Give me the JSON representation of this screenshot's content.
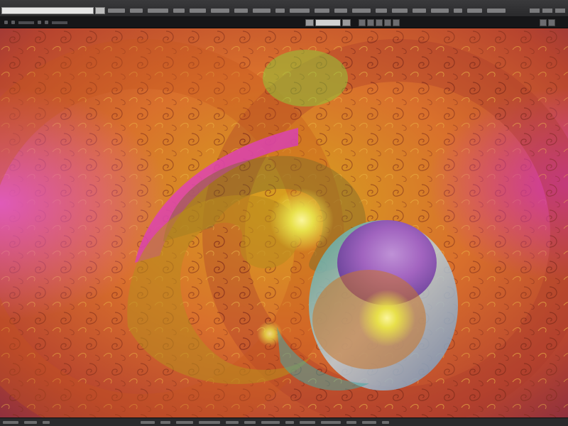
{
  "window": {
    "menu_item_count": 22,
    "accent": "#d2d2d2"
  },
  "icons": {
    "address_bar": "text-field",
    "go": "go-arrow-icon",
    "toolbar_center": [
      "frame-icon",
      "layers-icon",
      "swatch-icon"
    ]
  },
  "artwork": {
    "palette": {
      "orange": "#d9702c",
      "gold": "#d6a21e",
      "magenta": "#d23aa6",
      "purple": "#8a3fb0",
      "yellow": "#e8e04a",
      "teal": "#4aa7a0",
      "red": "#c83a2a"
    }
  }
}
